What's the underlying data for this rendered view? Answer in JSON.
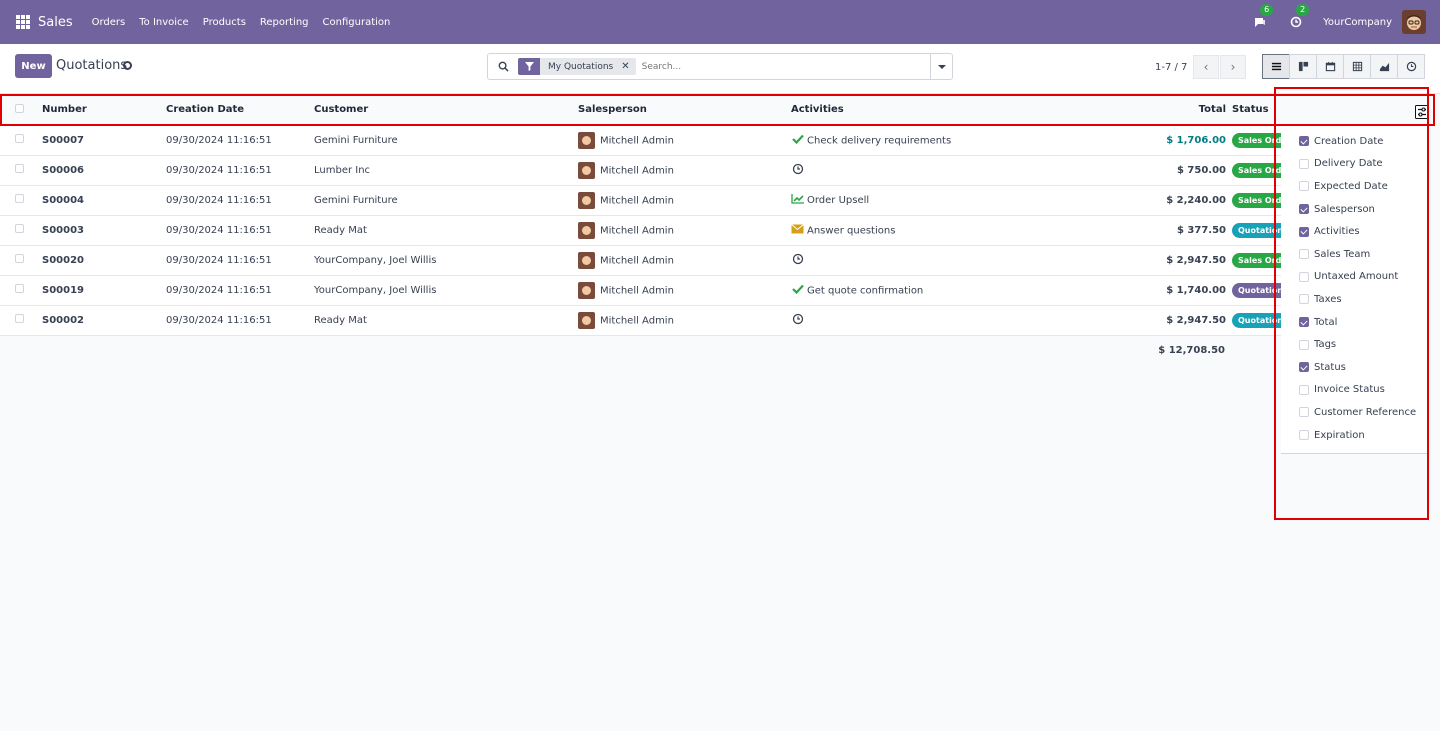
{
  "navbar": {
    "app_name": "Sales",
    "menu": [
      "Orders",
      "To Invoice",
      "Products",
      "Reporting",
      "Configuration"
    ],
    "messages_count": "6",
    "activities_count": "2",
    "company": "YourCompany"
  },
  "control_panel": {
    "new_label": "New",
    "title": "Quotations",
    "facet_label": "My Quotations",
    "facet_remove": "✕",
    "search_placeholder": "Search...",
    "pager": "1-7 / 7"
  },
  "columns": {
    "number": "Number",
    "creation_date": "Creation Date",
    "customer": "Customer",
    "salesperson": "Salesperson",
    "activities": "Activities",
    "total": "Total",
    "status": "Status"
  },
  "rows": [
    {
      "number": "S00007",
      "date": "09/30/2024 11:16:51",
      "customer": "Gemini Furniture",
      "salesperson": "Mitchell Admin",
      "activity_icon": "check-icon",
      "activity": "Check delivery requirements",
      "total": "$ 1,706.00",
      "status": "Sales Order"
    },
    {
      "number": "S00006",
      "date": "09/30/2024 11:16:51",
      "customer": "Lumber Inc",
      "salesperson": "Mitchell Admin",
      "activity_icon": "clock-icon",
      "activity": "",
      "total": "$ 750.00",
      "status": "Sales Order"
    },
    {
      "number": "S00004",
      "date": "09/30/2024 11:16:51",
      "customer": "Gemini Furniture",
      "salesperson": "Mitchell Admin",
      "activity_icon": "chart-line-icon",
      "activity": "Order Upsell",
      "total": "$ 2,240.00",
      "status": "Sales Order"
    },
    {
      "number": "S00003",
      "date": "09/30/2024 11:16:51",
      "customer": "Ready Mat",
      "salesperson": "Mitchell Admin",
      "activity_icon": "envelope-icon",
      "activity": "Answer questions",
      "total": "$ 377.50",
      "status": "Quotation"
    },
    {
      "number": "S00020",
      "date": "09/30/2024 11:16:51",
      "customer": "YourCompany, Joel Willis",
      "salesperson": "Mitchell Admin",
      "activity_icon": "clock-icon",
      "activity": "",
      "total": "$ 2,947.50",
      "status": "Sales Order"
    },
    {
      "number": "S00019",
      "date": "09/30/2024 11:16:51",
      "customer": "YourCompany, Joel Willis",
      "salesperson": "Mitchell Admin",
      "activity_icon": "check-icon",
      "activity": "Get quote confirmation",
      "total": "$ 1,740.00",
      "status": "Quotation Sent"
    },
    {
      "number": "S00002",
      "date": "09/30/2024 11:16:51",
      "customer": "Ready Mat",
      "salesperson": "Mitchell Admin",
      "activity_icon": "clock-icon",
      "activity": "",
      "total": "$ 2,947.50",
      "status": "Quotation"
    }
  ],
  "grand_total": "$ 12,708.50",
  "optional_columns": [
    {
      "label": "Creation Date",
      "checked": true
    },
    {
      "label": "Delivery Date",
      "checked": false
    },
    {
      "label": "Expected Date",
      "checked": false
    },
    {
      "label": "Salesperson",
      "checked": true
    },
    {
      "label": "Activities",
      "checked": true
    },
    {
      "label": "Sales Team",
      "checked": false
    },
    {
      "label": "Untaxed Amount",
      "checked": false
    },
    {
      "label": "Taxes",
      "checked": false
    },
    {
      "label": "Total",
      "checked": true
    },
    {
      "label": "Tags",
      "checked": false
    },
    {
      "label": "Status",
      "checked": true
    },
    {
      "label": "Invoice Status",
      "checked": false
    },
    {
      "label": "Customer Reference",
      "checked": false
    },
    {
      "label": "Expiration",
      "checked": false
    }
  ],
  "colors": {
    "brand": "#71639e",
    "sales_order": "#28a745",
    "quotation": "#17a2b8",
    "quotation_sent": "#71639e",
    "link_total": "#017e84",
    "annotation": "#e00000"
  }
}
